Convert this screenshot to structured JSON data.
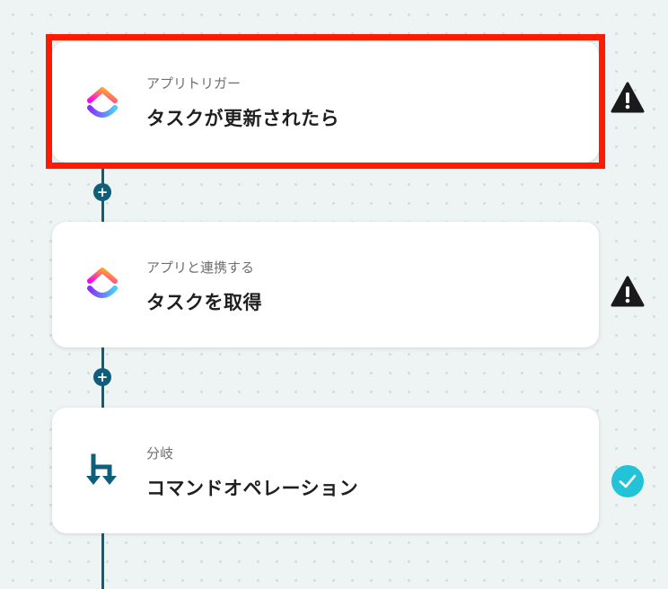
{
  "flow": {
    "steps": [
      {
        "type_label": "アプリトリガー",
        "title": "タスクが更新されたら",
        "icon": "clickup-logo-icon",
        "status": "warning-icon"
      },
      {
        "type_label": "アプリと連携する",
        "title": "タスクを取得",
        "icon": "clickup-logo-icon",
        "status": "warning-icon"
      },
      {
        "type_label": "分岐",
        "title": "コマンドオペレーション",
        "icon": "branch-icon",
        "status": "check-icon"
      }
    ],
    "add_button_symbol": "+"
  },
  "colors": {
    "connector": "#0f5f7a",
    "highlight": "#ff1a00",
    "warning": "#1a1a1a",
    "check": "#22c3d6",
    "branch_icon": "#0f5f7a"
  }
}
